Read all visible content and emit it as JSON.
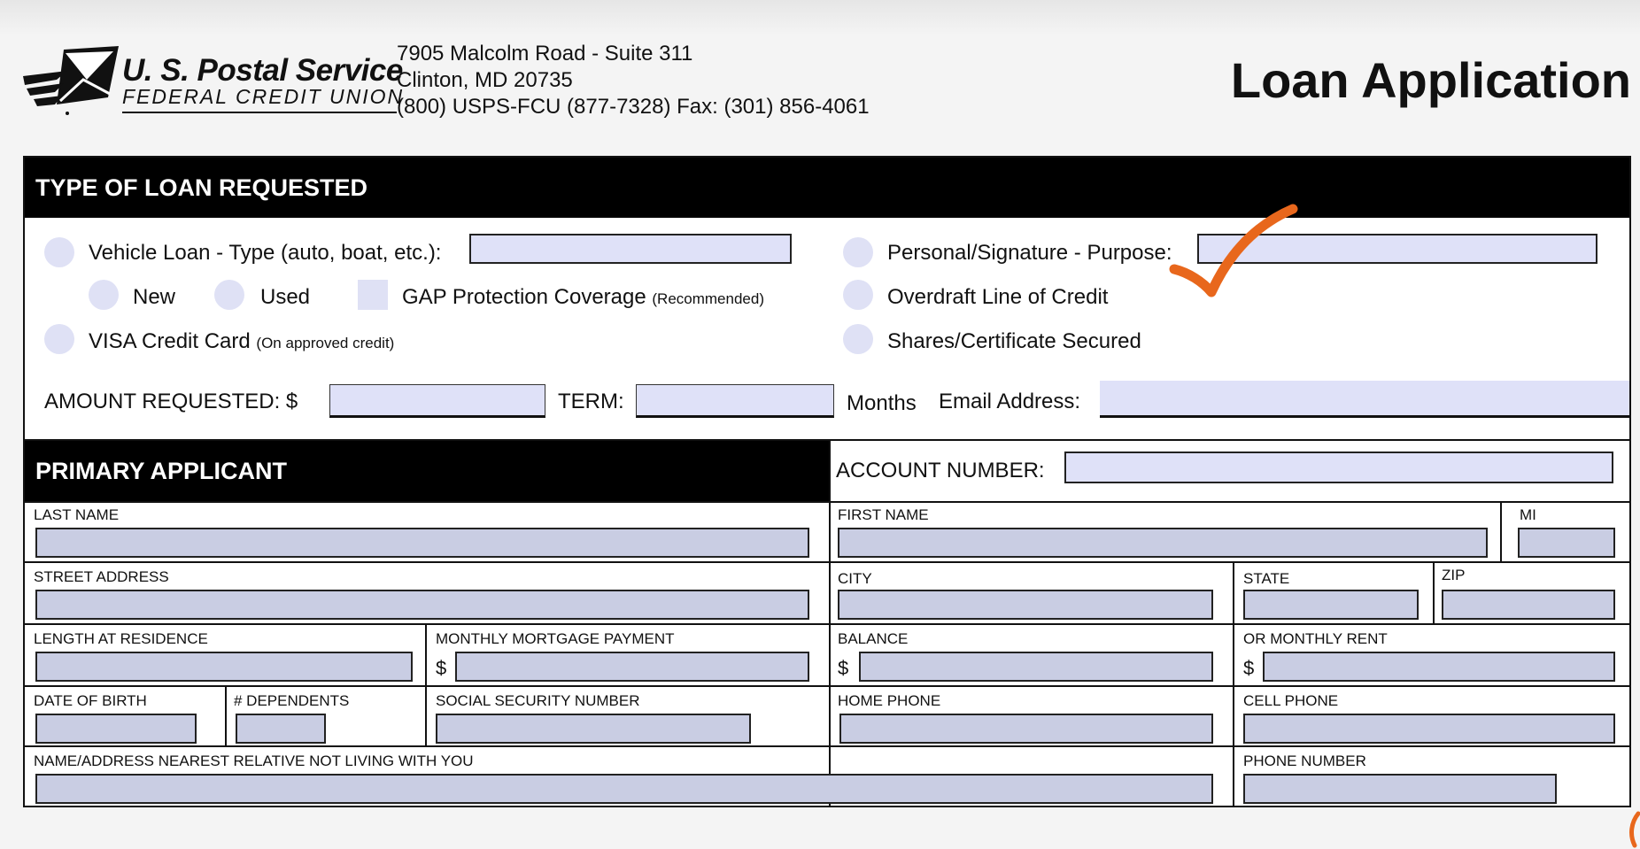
{
  "header": {
    "logo_title": "U. S. Postal Service",
    "logo_subtitle": "FEDERAL CREDIT UNION",
    "address_line1": "7905 Malcolm Road - Suite 311",
    "address_line2": "Clinton, MD 20735",
    "address_line3": "(800) USPS-FCU (877-7328) Fax: (301) 856-4061",
    "title": "Loan Application"
  },
  "loan_type": {
    "section_title": "TYPE OF LOAN REQUESTED",
    "vehicle_label": "Vehicle Loan - Type (auto, boat, etc.):",
    "vehicle_type_value": "",
    "new_label": "New",
    "used_label": "Used",
    "gap_label": "GAP Protection Coverage",
    "gap_note": "(Recommended)",
    "visa_label": "VISA Credit Card",
    "visa_note": "(On approved credit)",
    "personal_label": "Personal/Signature - Purpose:",
    "personal_purpose_value": "",
    "overdraft_label": "Overdraft Line of Credit",
    "shares_label": "Shares/Certificate Secured",
    "amount_label": "AMOUNT REQUESTED: $",
    "amount_value": "",
    "term_label": "TERM:",
    "term_value": "",
    "months_label": "Months",
    "email_label": "Email Address:",
    "email_value": ""
  },
  "primary": {
    "section_title": "PRIMARY APPLICANT",
    "account_label": "ACCOUNT NUMBER:",
    "account_value": "",
    "last_name": "LAST NAME",
    "first_name": "FIRST NAME",
    "mi": "MI",
    "street": "STREET ADDRESS",
    "city": "CITY",
    "state": "STATE",
    "zip": "ZIP",
    "length_residence": "LENGTH AT RESIDENCE",
    "mortgage": "MONTHLY MORTGAGE PAYMENT",
    "balance": "BALANCE",
    "rent": "OR MONTHLY RENT",
    "dollar": "$",
    "dob": "DATE OF BIRTH",
    "dependents": "# DEPENDENTS",
    "ssn": "SOCIAL SECURITY NUMBER",
    "home_phone": "HOME PHONE",
    "cell_phone": "CELL PHONE",
    "relative": "NAME/ADDRESS  NEAREST RELATIVE NOT LIVING WITH YOU",
    "phone_number": "PHONE NUMBER"
  },
  "colors": {
    "field_fill": "#dfe1f8",
    "row_field_fill": "#c9cde3",
    "annotation_orange": "#e8671c"
  },
  "icons": {
    "logo": "eagle-envelope-logo-icon",
    "annotation": "orange-checkmark-icon"
  }
}
